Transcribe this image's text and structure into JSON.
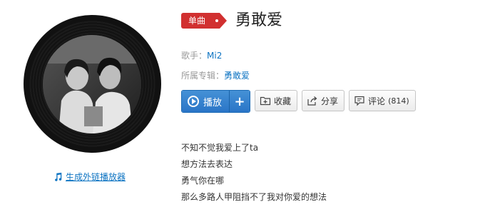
{
  "tag_label": "单曲",
  "song": {
    "title": "勇敢爱"
  },
  "singer": {
    "label": "歌手：",
    "name": "Mi2"
  },
  "album": {
    "label": "所属专辑：",
    "name": "勇敢爱"
  },
  "buttons": {
    "play": "播放",
    "add": "+",
    "collect": "收藏",
    "share": "分享",
    "comment": "评论",
    "comment_count": "(814)"
  },
  "external_player_link": "生成外链播放器",
  "lyrics": [
    "不知不觉我爱上了ta",
    "想方法去表达",
    "勇气你在哪",
    "那么多路人甲阻挡不了我对你爱的想法"
  ],
  "colors": {
    "accent_blue": "#2a75c7",
    "tag_red": "#d13030",
    "link_blue": "#0c73c2"
  }
}
